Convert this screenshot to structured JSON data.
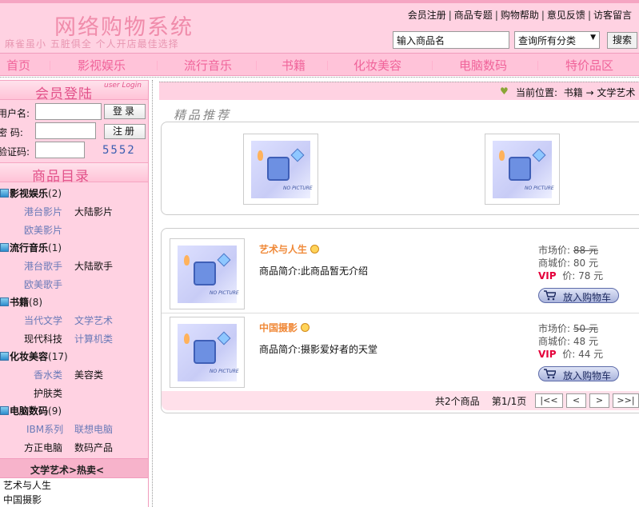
{
  "header": {
    "logo_title": "网络购物系统",
    "logo_slogan": "麻雀虽小 五脏俱全  个人开店最佳选择",
    "top_links": [
      "会员注册",
      "商品专题",
      "购物帮助",
      "意见反馈",
      "访客留言"
    ],
    "search": {
      "value": "输入商品名",
      "category_selected": "查询所有分类",
      "button_label": "搜索"
    }
  },
  "nav": {
    "items": [
      "首页",
      "影视娱乐",
      "流行音乐",
      "书籍",
      "化妆美容",
      "电脑数码",
      "特价品区"
    ]
  },
  "login": {
    "title": "会员登陆",
    "subtitle": "user Login",
    "username_label": "用户名:",
    "password_label": "密  码:",
    "captcha_label": "验证码:",
    "login_button": "登录",
    "register_button": "注册",
    "captcha_code": "5552"
  },
  "catalog": {
    "title": "商品目录",
    "categories": [
      {
        "name": "影视娱乐",
        "count": "(2)",
        "subs": [
          "港台影片",
          "大陆影片",
          "欧美影片"
        ]
      },
      {
        "name": "流行音乐",
        "count": "(1)",
        "subs": [
          "港台歌手",
          "大陆歌手",
          "欧美歌手"
        ]
      },
      {
        "name": "书籍",
        "count": "(8)",
        "subs": [
          "当代文学",
          "文学艺术",
          "现代科技",
          "计算机类"
        ]
      },
      {
        "name": "化妆美容",
        "count": "(17)",
        "subs": [
          "香水类",
          "美容类",
          "护肤类"
        ]
      },
      {
        "name": "电脑数码",
        "count": "(9)",
        "subs": [
          "IBM系列",
          "联想电脑",
          "方正电脑",
          "数码产品"
        ]
      }
    ]
  },
  "hot": {
    "title": "文学艺术>热卖<",
    "items": [
      "艺术与人生",
      "中国摄影"
    ]
  },
  "location": {
    "label": "当前位置:",
    "path": "书籍 → 文学艺术"
  },
  "recommend": {
    "title": "精品推荐",
    "nopic_text": "NO PICTURE"
  },
  "products": [
    {
      "name": "艺术与人生",
      "desc": "商品简介:此商品暂无介绍",
      "market_label": "市场价:",
      "market_price": "88 元",
      "shop_label": "商城价:",
      "shop_price": "80 元",
      "vip_label": "VIP",
      "vip_price_label": "价:",
      "vip_price": "78 元",
      "cart_label": "放入购物车"
    },
    {
      "name": "中国摄影",
      "desc": "商品简介:摄影爱好者的天堂",
      "market_label": "市场价:",
      "market_price": "50 元",
      "shop_label": "商城价:",
      "shop_price": "48 元",
      "vip_label": "VIP",
      "vip_price_label": "价:",
      "vip_price": "44 元",
      "cart_label": "放入购物车"
    }
  ],
  "pager": {
    "total": "共2个商品",
    "page": "第1/1页",
    "first": "|<<",
    "prev": "<",
    "next": ">",
    "last": ">>|"
  },
  "colors": {
    "header_bg": "#ffd2e2",
    "nav_bg": "#ffc3d9",
    "nav_text": "#f0649a",
    "product_name": "#f08a3a",
    "vip": "#e4003a"
  }
}
